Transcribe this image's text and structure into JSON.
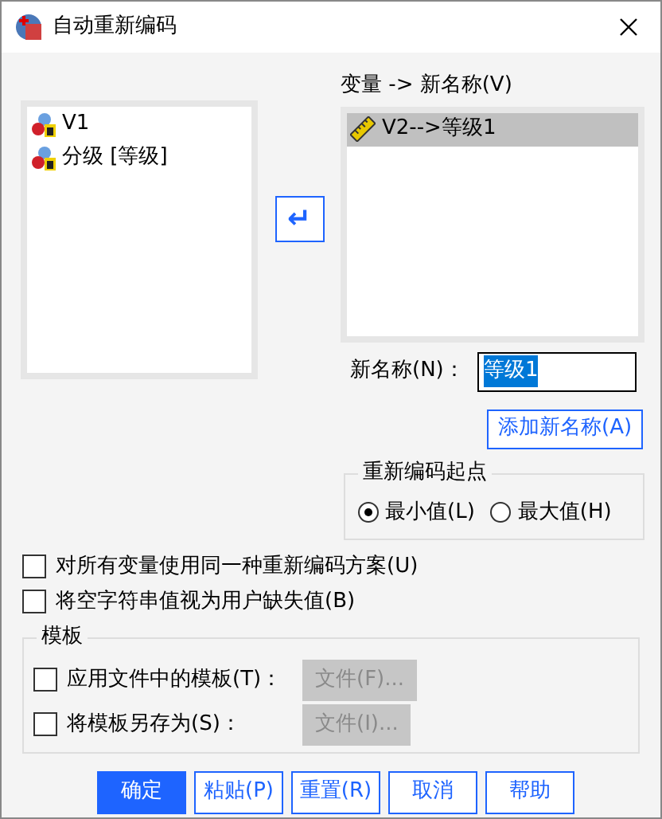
{
  "window": {
    "title": "自动重新编码"
  },
  "source_list": {
    "items": [
      {
        "label": "V1",
        "kind": "nominal"
      },
      {
        "label": "分级 [等级]",
        "kind": "nominal"
      }
    ]
  },
  "move_button": {
    "glyph": "↵"
  },
  "target_list": {
    "label": "变量 -> 新名称(V)",
    "items": [
      {
        "label": "V2-->等级1",
        "kind": "scale",
        "selected": true
      }
    ]
  },
  "new_name": {
    "label": "新名称(N)：",
    "value": "等级1"
  },
  "add_button": {
    "label": "添加新名称(A)"
  },
  "recode_start": {
    "title": "重新编码起点",
    "options": [
      {
        "label": "最小值(L)",
        "selected": true
      },
      {
        "label": "最大值(H)",
        "selected": false
      }
    ]
  },
  "checkboxes": [
    {
      "label": "对所有变量使用同一种重新编码方案(U)",
      "checked": false
    },
    {
      "label": "将空字符串值视为用户缺失值(B)",
      "checked": false
    }
  ],
  "template": {
    "title": "模板",
    "rows": [
      {
        "label": "应用文件中的模板(T)：",
        "checked": false,
        "button": "文件(F)...",
        "disabled": true
      },
      {
        "label": "将模板另存为(S)：",
        "checked": false,
        "button": "文件(I)...",
        "disabled": true
      }
    ]
  },
  "buttons": [
    {
      "label": "确定",
      "primary": true
    },
    {
      "label": "粘贴(P)",
      "primary": false
    },
    {
      "label": "重置(R)",
      "primary": false
    },
    {
      "label": "取消",
      "primary": false
    },
    {
      "label": "帮助",
      "primary": false
    }
  ]
}
